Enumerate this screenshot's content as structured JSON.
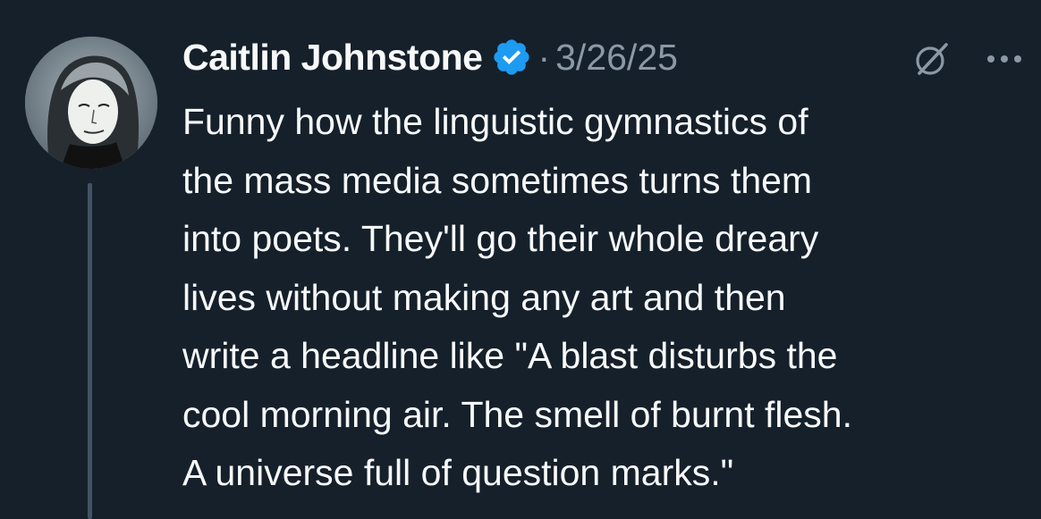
{
  "author": {
    "name": "Caitlin Johnstone",
    "separator": "·",
    "date": "3/26/25",
    "verified_icon": "verified-badge-icon",
    "verified_color": "#1d9bf0"
  },
  "actions": {
    "grok_icon": "grok-icon",
    "more_icon": "more-options-icon"
  },
  "tweet": {
    "lines": [
      "Funny how the linguistic gymnastics of",
      "the mass media sometimes turns them",
      "into poets. They'll go their whole dreary",
      "lives without making any art and then",
      "write a headline like \"A blast disturbs the",
      "cool morning air. The smell of burnt flesh.",
      "A universe full of question marks.\""
    ]
  },
  "colors": {
    "background": "#15202b",
    "text": "#f7f9f9",
    "secondary_text": "#8b98a5",
    "thread_line": "#425364"
  }
}
